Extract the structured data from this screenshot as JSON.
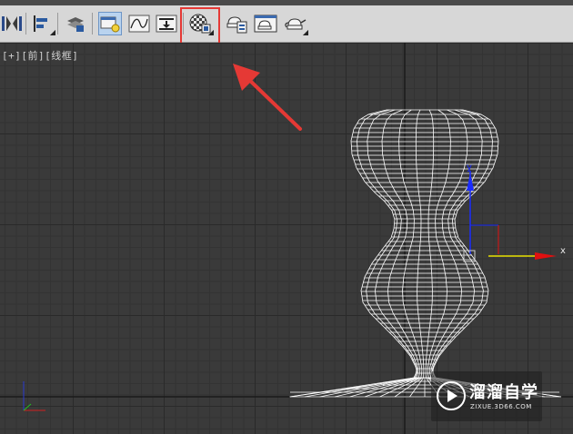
{
  "toolbar": {
    "buttons": [
      {
        "id": "mirror",
        "icon": "mirror-icon"
      },
      {
        "id": "align",
        "icon": "align-icon"
      },
      {
        "id": "layers",
        "icon": "layer-explorer-icon"
      },
      {
        "id": "scene-explorer",
        "icon": "scene-explorer-icon",
        "active": true
      },
      {
        "id": "curve-editor",
        "icon": "curve-editor-icon"
      },
      {
        "id": "schematic-view",
        "icon": "schematic-view-icon"
      },
      {
        "id": "material-editor",
        "icon": "material-editor-icon",
        "highlighted": true
      },
      {
        "id": "render-setup",
        "icon": "render-setup-icon"
      },
      {
        "id": "rendered-frame-window",
        "icon": "rendered-frame-window-icon"
      },
      {
        "id": "render-production",
        "icon": "render-teapot-icon"
      }
    ],
    "highlight_color": "#e53935"
  },
  "viewport": {
    "label_plus": "[+]",
    "label_view": "[前]",
    "label_mode": "[线框]",
    "background": "#3a3a3a",
    "wire_color": "#ffffff"
  },
  "gizmo": {
    "x_label": "x",
    "x_axis_color": "#e8e000",
    "y_axis_color": "#1a2cff",
    "x_arrow_color": "#e01010"
  },
  "annotation": {
    "arrow_color": "#e53935"
  },
  "watermark": {
    "text": "溜溜自学",
    "sub": "ZIXUE.3D66.COM"
  }
}
